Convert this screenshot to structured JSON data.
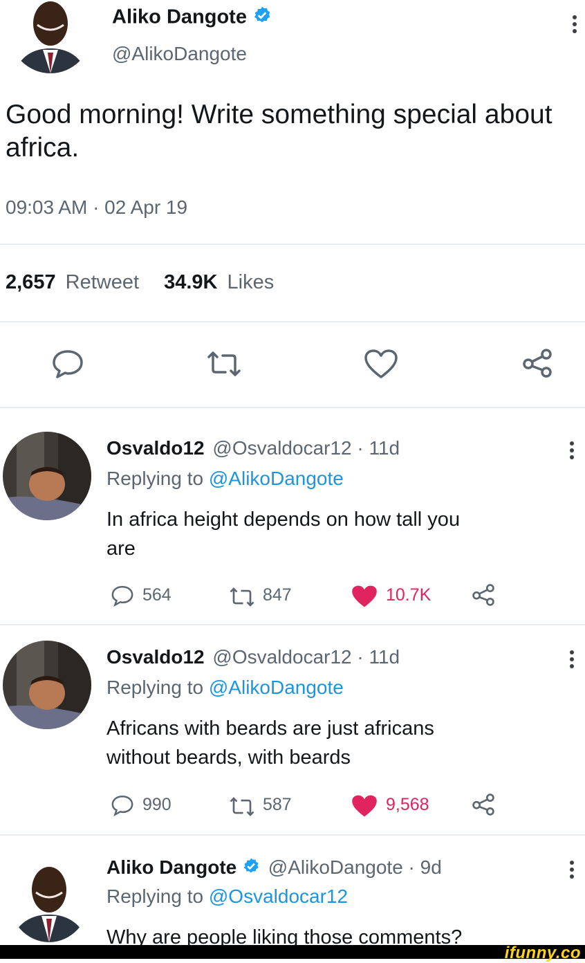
{
  "main_tweet": {
    "name": "Aliko Dangote",
    "handle": "@AlikoDangote",
    "text": "Good morning! Write something special about africa.",
    "timestamp": "09:03 AM · 02 Apr 19",
    "retweet_count": "2,657",
    "retweet_label": "Retweet",
    "like_count": "34.9K",
    "like_label": "Likes"
  },
  "replies": [
    {
      "name": "Osvaldo12",
      "handle_meta": "@Osvaldocar12 · 11d",
      "replying_prefix": "Replying to ",
      "replying_to": "@AlikoDangote",
      "text_line1": "In africa height depends on how tall you",
      "text_line2": "are",
      "reply_count": "564",
      "retweet_count": "847",
      "like_count": "10.7K"
    },
    {
      "name": "Osvaldo12",
      "handle_meta": "@Osvaldocar12 · 11d",
      "replying_prefix": "Replying to ",
      "replying_to": "@AlikoDangote",
      "text_line1": "Africans with beards are just africans",
      "text_line2": "without beards, with beards",
      "reply_count": "990",
      "retweet_count": "587",
      "like_count": "9,568"
    },
    {
      "name": "Aliko Dangote",
      "handle_meta": "@AlikoDangote · 9d",
      "replying_prefix": "Replying to ",
      "replying_to": "@Osvaldocar12",
      "text_line1": "Why are people liking those comments?"
    }
  ],
  "watermark": "ifunny.co",
  "colors": {
    "link_blue": "#1b95e0",
    "verified_blue": "#1da1f2",
    "liked_red": "#e0245e",
    "muted_gray": "#5b6670"
  },
  "icons": [
    "verified-badge-icon",
    "reply-icon",
    "retweet-icon",
    "heart-icon",
    "share-icon",
    "more-options-icon"
  ]
}
